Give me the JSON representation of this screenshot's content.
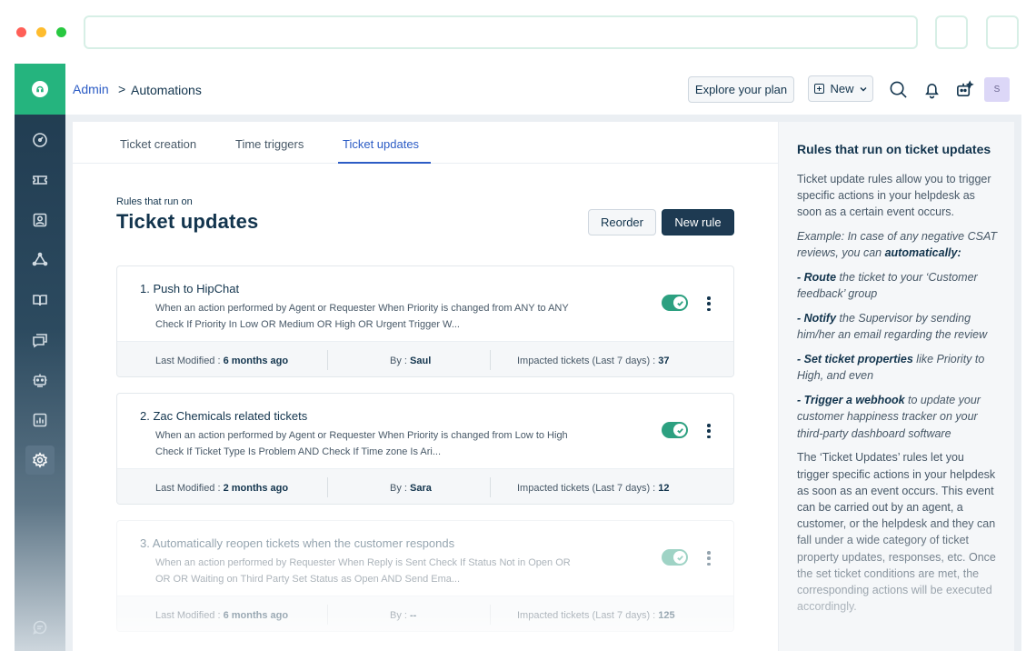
{
  "header": {
    "breadcrumb_root": "Admin",
    "breadcrumb_sep": ">",
    "breadcrumb_current": "Automations",
    "explore_label": "Explore your plan",
    "new_label": "New",
    "avatar_initial": "S"
  },
  "tabs": [
    "Ticket creation",
    "Time triggers",
    "Ticket updates"
  ],
  "active_tab": "Ticket updates",
  "page": {
    "subtitle": "Rules that run on",
    "title": "Ticket updates",
    "reorder_label": "Reorder",
    "new_rule_label": "New rule"
  },
  "rules": [
    {
      "title": "1. Push to HipChat",
      "desc_line1": "When an action performed by Agent or Requester When Priority is changed from ANY to ANY",
      "desc_line2": "Check If Priority In Low OR Medium OR High OR Urgent Trigger W...",
      "enabled": true,
      "modified_label": "Last Modified : ",
      "modified_value": "6 months ago",
      "by_label": "By : ",
      "by_value": "Saul",
      "impacted_label": "Impacted tickets (Last 7 days) : ",
      "impacted_value": "37"
    },
    {
      "title": "2. Zac Chemicals related tickets",
      "desc_line1": "When an action performed by Agent or Requester When Priority is changed from Low to High",
      "desc_line2": "Check If Ticket Type Is Problem AND Check If Time zone Is Ari...",
      "enabled": true,
      "modified_label": "Last Modified : ",
      "modified_value": "2 months ago",
      "by_label": "By : ",
      "by_value": "Sara",
      "impacted_label": "Impacted tickets (Last 7 days) : ",
      "impacted_value": "12"
    },
    {
      "title": "3. Automatically reopen tickets when the customer responds",
      "desc_line1": "When an action performed by Requester When Reply is Sent Check If Status Not in Open OR",
      "desc_line2": "OR OR Waiting on Third Party Set Status as Open AND Send Ema...",
      "enabled": true,
      "modified_label": "Last Modified : ",
      "modified_value": "6 months ago",
      "by_label": "By : ",
      "by_value": "--",
      "impacted_label": "Impacted tickets (Last 7 days) : ",
      "impacted_value": "125"
    }
  ],
  "info_panel": {
    "title": "Rules that run on ticket updates",
    "intro": "Ticket update rules allow you to trigger specific actions in your helpdesk as soon as a certain event occurs.",
    "example_prefix": "Example: In case of any negative CSAT reviews, you can ",
    "example_bold": "automatically:",
    "bullet1_bold": "- Route",
    "bullet1_text": " the ticket to your ‘Customer feedback’ group",
    "bullet2_bold": "- Notify",
    "bullet2_text": " the Supervisor by sending him/her an email regarding the review",
    "bullet3_bold": "- Set ticket properties",
    "bullet3_text": " like Priority to High, and even",
    "bullet4_bold": "- Trigger a webhook",
    "bullet4_text": " to update your customer happiness tracker on your third-party dashboard software",
    "outro": "The ‘Ticket Updates’ rules let you trigger specific actions in your helpdesk as soon as an event occurs. This event can be carried out by an agent, a customer, or the helpdesk and they can fall under a wide category of ticket property updates, responses, etc. Once the set ticket conditions are met, the corresponding actions will be executed accordingly."
  },
  "sidebar_icons": [
    "logo-icon",
    "dashboard-icon",
    "tickets-icon",
    "contacts-icon",
    "groups-icon",
    "solutions-icon",
    "forums-icon",
    "bot-icon",
    "reports-icon",
    "admin-gear-icon",
    "chat-icon"
  ],
  "colors": {
    "brand_green": "#25b47e",
    "sidebar_dark": "#1f3a4f",
    "link_blue": "#2c5cc5",
    "primary_dark": "#1e3a52",
    "toggle_green": "#2ca080",
    "avatar_bg": "#dcd7f7"
  }
}
